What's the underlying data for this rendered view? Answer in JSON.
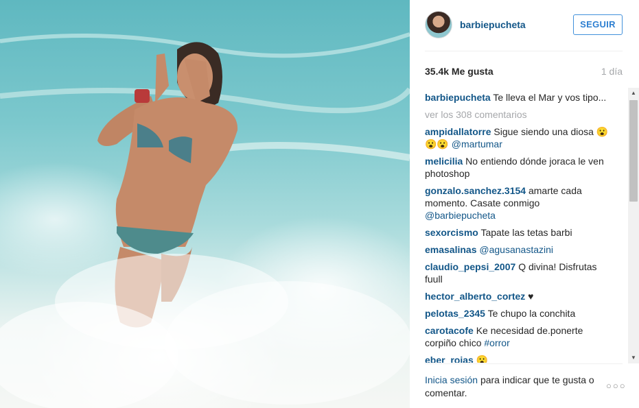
{
  "post": {
    "username": "barbiepucheta",
    "follow_label": "SEGUIR",
    "likes": "35.4k Me gusta",
    "time_ago": "1 día",
    "caption": {
      "user": "barbiepucheta",
      "text": "Te lleva el Mar y vos tipo..."
    },
    "view_more": "ver los 308 comentarios"
  },
  "comments": [
    {
      "user": "ampidallatorre",
      "text": "Sigue siendo una diosa 😮😮😮",
      "mention": "@martumar"
    },
    {
      "user": "melicilia",
      "text": "No entiendo dónde joraca le ven photoshop",
      "mention": ""
    },
    {
      "user": "gonzalo.sanchez.3154",
      "text": "amarte cada momento. Casate conmigo",
      "mention": "@barbiepucheta"
    },
    {
      "user": "sexorcismo",
      "text": "Tapate las tetas barbi",
      "mention": ""
    },
    {
      "user": "emasalinas",
      "text": "",
      "mention": "@agusanastazini"
    },
    {
      "user": "claudio_pepsi_2007",
      "text": "Q divina! Disfrutas fuull",
      "mention": ""
    },
    {
      "user": "hector_alberto_cortez",
      "text": "♥",
      "mention": ""
    },
    {
      "user": "pelotas_2345",
      "text": "Te chupo la conchita",
      "mention": ""
    },
    {
      "user": "carotacofe",
      "text": "Ke necesidad de.ponerte corpiño chico",
      "mention": "#orror"
    },
    {
      "user": "eber_rojas",
      "text": "😮",
      "mention": ""
    }
  ],
  "footer": {
    "login_link": "Inicia sesión",
    "login_text": "para indicar que te gusta o comentar.",
    "more_icon": "more-options-icon"
  },
  "scrollbar": {
    "up_arrow": "▲",
    "down_arrow": "▼"
  },
  "colors": {
    "username": "#125688",
    "follow_border": "#4090db",
    "muted": "#a5a7aa"
  }
}
